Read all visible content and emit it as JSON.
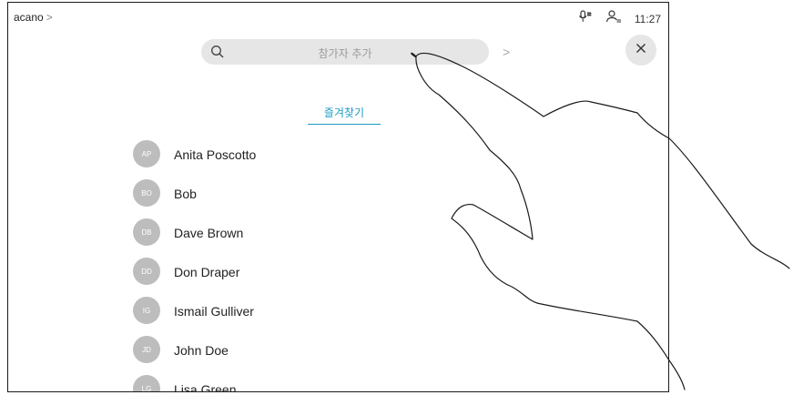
{
  "header": {
    "breadcrumb": "acano",
    "breadcrumb_chevron": ">",
    "time": "11:27"
  },
  "search": {
    "placeholder": "참가자 추가",
    "next_chevron": ">"
  },
  "tabs": {
    "favorites": "즐겨찾기"
  },
  "contacts": [
    {
      "initials": "AP",
      "name": "Anita Poscotto"
    },
    {
      "initials": "BO",
      "name": "Bob"
    },
    {
      "initials": "DB",
      "name": "Dave Brown"
    },
    {
      "initials": "DD",
      "name": "Don Draper"
    },
    {
      "initials": "IG",
      "name": "Ismail Gulliver"
    },
    {
      "initials": "JD",
      "name": "John Doe"
    },
    {
      "initials": "LG",
      "name": "Lisa Green"
    }
  ],
  "icons": {
    "mic": "microphone-mute-icon",
    "user": "user-list-icon",
    "search": "search-icon",
    "close": "close-icon"
  },
  "colors": {
    "accent": "#1b9bc2",
    "avatar": "#bdbdbd",
    "search_bg": "#e6e6e6"
  }
}
